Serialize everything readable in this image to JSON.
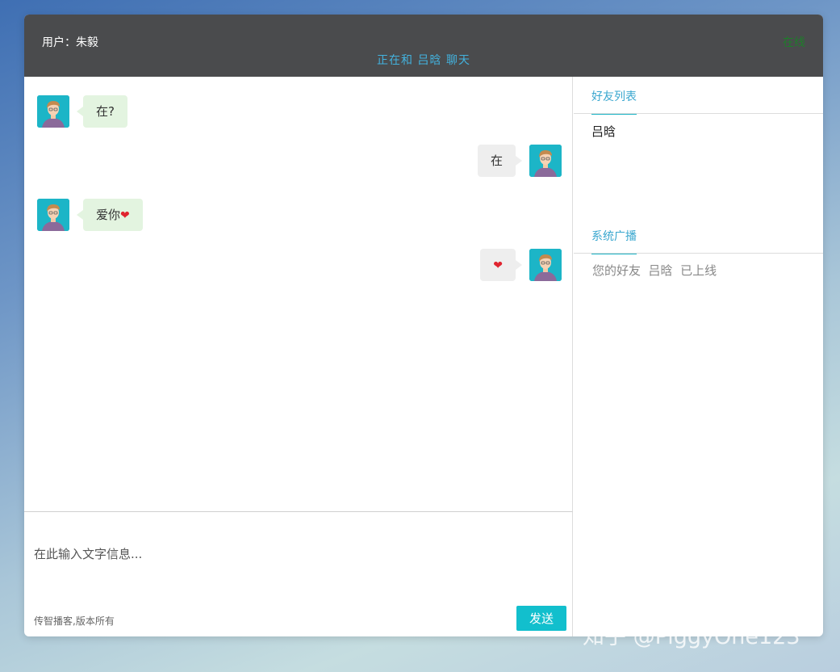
{
  "header": {
    "user_label": "用户：朱毅",
    "chatting_with": "正在和 吕晗 聊天",
    "status": "在线"
  },
  "messages": [
    {
      "side": "left",
      "text": "在?",
      "emoji": ""
    },
    {
      "side": "right",
      "text": "在",
      "emoji": ""
    },
    {
      "side": "left",
      "text": "爱你",
      "emoji": "❤"
    },
    {
      "side": "right",
      "text": "",
      "emoji": "❤"
    }
  ],
  "input": {
    "placeholder": "在此输入文字信息...",
    "value": ""
  },
  "footer": {
    "copyright": "传智播客,版本所有",
    "send_label": "发送"
  },
  "sidebar": {
    "friends_title": "好友列表",
    "friends": [
      "吕晗"
    ],
    "broadcast_title": "系统广播",
    "broadcast_message": "您的好友  吕晗  已上线"
  },
  "watermark": "知乎 @PiggyOne123",
  "icons": {
    "avatar": "user-avatar-icon",
    "emoji": "heart-emoji-icon"
  },
  "colors": {
    "header_bg": "#4a4b4d",
    "accent": "#1cb5c7",
    "send_button": "#12bfcd",
    "left_bubble": "#e3f4e0",
    "right_bubble": "#eeeeee",
    "status_online": "#1e7d2a",
    "heart": "#e0242f"
  }
}
